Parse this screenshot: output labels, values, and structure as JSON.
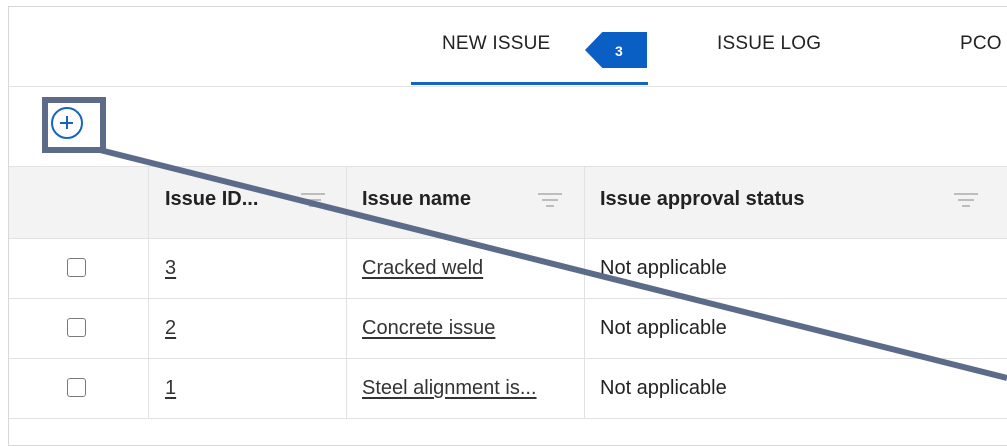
{
  "tabs": {
    "new_issue": "NEW ISSUE",
    "new_issue_count": "3",
    "issue_log": "ISSUE LOG",
    "pco": "PCO"
  },
  "table": {
    "columns": [
      "Issue ID...",
      "Issue name",
      "Issue approval status"
    ],
    "rows": [
      {
        "id": "3",
        "name": "Cracked weld",
        "status": "Not applicable"
      },
      {
        "id": "2",
        "name": "Concrete issue",
        "status": "Not applicable"
      },
      {
        "id": "1",
        "name": "Steel alignment is...",
        "status": "Not applicable"
      }
    ]
  },
  "colors": {
    "accent": "#1565c0",
    "badge": "#0a5fc4",
    "highlight": "#5b6b89"
  }
}
